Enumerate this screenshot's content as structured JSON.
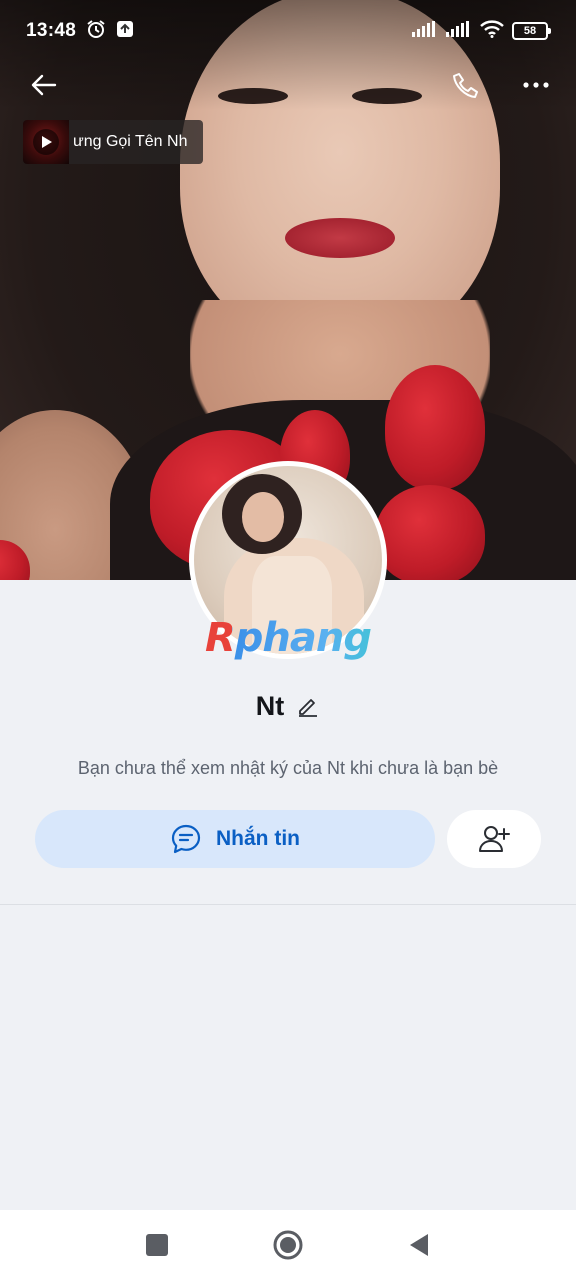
{
  "status_bar": {
    "time": "13:48",
    "battery": "58",
    "icons": [
      "alarm-icon",
      "upload-notification-icon",
      "signal-icon",
      "signal-icon",
      "wifi-icon",
      "battery-icon"
    ]
  },
  "top_bar": {
    "back_icon": "arrow-left-icon",
    "call_icon": "phone-icon",
    "more_icon": "more-horizontal-icon"
  },
  "music": {
    "title": "ưng Gọi Tên Nh",
    "play_icon": "play-icon"
  },
  "profile": {
    "name": "Nt",
    "watermark": "Rphang",
    "notice": "Bạn chưa thể xem nhật ký của Nt khi chưa là bạn bè"
  },
  "actions": {
    "message_label": "Nhắn tin",
    "message_icon": "chat-bubble-icon",
    "add_friend_icon": "add-friend-icon"
  },
  "colors": {
    "accent": "#0a5fc4",
    "message_button_bg": "#d8e7fb",
    "page_bg": "#eff1f5"
  },
  "nav_bar": {
    "icons": [
      "recents-square-icon",
      "home-circle-icon",
      "back-triangle-icon"
    ]
  }
}
